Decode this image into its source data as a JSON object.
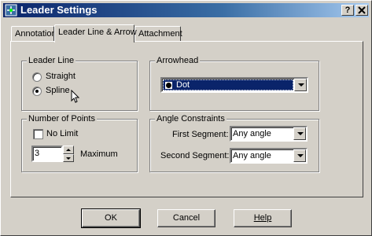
{
  "window": {
    "title": "Leader Settings",
    "help_button": "?",
    "close_button": "x"
  },
  "tabs": [
    {
      "label": "Annotation",
      "active": false
    },
    {
      "label": "Leader Line & Arrow",
      "active": true
    },
    {
      "label": "Attachment",
      "active": false
    }
  ],
  "leader_line": {
    "legend": "Leader Line",
    "options": [
      {
        "label": "Straight",
        "selected": false
      },
      {
        "label": "Spline",
        "selected": true
      }
    ]
  },
  "arrowhead": {
    "legend": "Arrowhead",
    "value": "Dot"
  },
  "number_of_points": {
    "legend": "Number of Points",
    "no_limit_label": "No Limit",
    "no_limit_checked": false,
    "value": "3",
    "maximum_label": "Maximum"
  },
  "angle_constraints": {
    "legend": "Angle Constraints",
    "first_segment_label": "First Segment:",
    "first_segment_value": "Any angle",
    "second_segment_label": "Second Segment:",
    "second_segment_value": "Any angle"
  },
  "buttons": {
    "ok": "OK",
    "cancel": "Cancel",
    "help": "Help"
  },
  "colors": {
    "title_bar": "#0a246a",
    "selection": "#0a246a",
    "face": "#d4d0c8"
  },
  "icons": [
    "app-icon",
    "cursor-icon",
    "dot-arrowhead-icon",
    "chevron-down-icon"
  ]
}
